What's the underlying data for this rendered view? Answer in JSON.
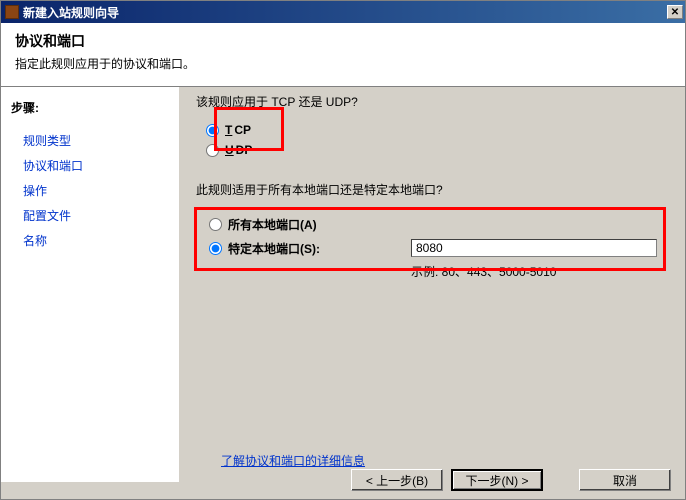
{
  "titlebar": {
    "title": "新建入站规则向导"
  },
  "header": {
    "title": "协议和端口",
    "subtitle": "指定此规则应用于的协议和端口。"
  },
  "sidebar": {
    "label": "步骤:",
    "items": [
      {
        "label": "规则类型"
      },
      {
        "label": "协议和端口"
      },
      {
        "label": "操作"
      },
      {
        "label": "配置文件"
      },
      {
        "label": "名称"
      }
    ]
  },
  "main": {
    "question1": "该规则应用于 TCP 还是 UDP?",
    "tcp_prefix": "T",
    "tcp_rest": "CP",
    "udp_prefix": "U",
    "udp_rest": "DP",
    "question2": "此规则适用于所有本地端口还是特定本地端口?",
    "all_ports_label": "所有本地端口(A)",
    "specific_ports_label": "特定本地端口(S):",
    "port_value": "8080",
    "example": "示例: 80、443、5000-5010",
    "details_link": "了解协议和端口的详细信息"
  },
  "footer": {
    "back": "< 上一步(B)",
    "next": "下一步(N) >",
    "cancel": "取消"
  }
}
